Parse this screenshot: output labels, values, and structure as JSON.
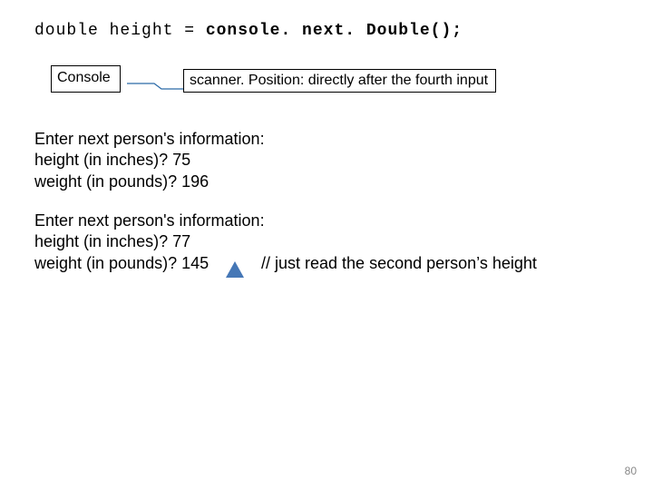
{
  "code": {
    "prefix": "double height = ",
    "bold": "console. next. Double();"
  },
  "consoleLabel": "Console",
  "scannerLabel": "scanner. Position:  directly after the fourth input",
  "block1": {
    "l1": "Enter next person's information:",
    "l2": "height (in inches)?  75",
    "l3": "weight (in pounds)? 196"
  },
  "block2": {
    "l1": "Enter next person's information:",
    "l2": "height (in inches)?  77",
    "l3": "weight (in pounds)? 145"
  },
  "comment": "// just read the second person’s height",
  "pageNumber": "80"
}
